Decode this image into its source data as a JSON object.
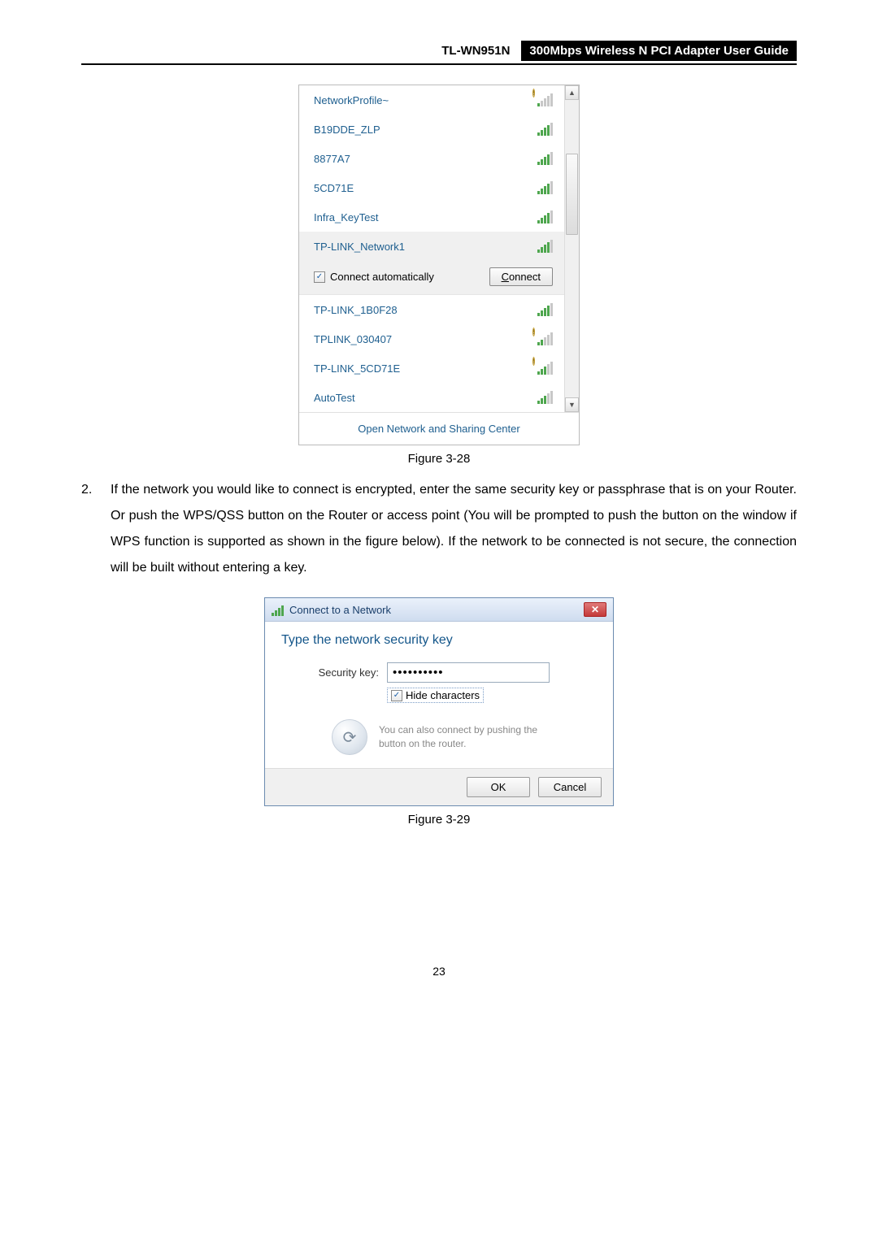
{
  "header": {
    "model": "TL-WN951N",
    "title": "300Mbps Wireless N PCI Adapter User Guide"
  },
  "wifi_panel": {
    "networks": [
      {
        "name": "NetworkProfile~",
        "strength": 1,
        "secured": true
      },
      {
        "name": "B19DDE_ZLP",
        "strength": 4,
        "secured": false
      },
      {
        "name": "8877A7",
        "strength": 4,
        "secured": false
      },
      {
        "name": "5CD71E",
        "strength": 4,
        "secured": false
      },
      {
        "name": "Infra_KeyTest",
        "strength": 4,
        "secured": false
      },
      {
        "name": "TP-LINK_Network1",
        "strength": 4,
        "secured": false,
        "selected": true
      }
    ],
    "connect": {
      "auto_label": "Connect automatically",
      "auto_checked": true,
      "button_label": "Connect",
      "button_underline": "C"
    },
    "networks_after": [
      {
        "name": "TP-LINK_1B0F28",
        "strength": 4,
        "secured": false
      },
      {
        "name": "TPLINK_030407",
        "strength": 2,
        "secured": true
      },
      {
        "name": "TP-LINK_5CD71E",
        "strength": 3,
        "secured": true
      },
      {
        "name": "AutoTest",
        "strength": 3,
        "secured": false
      }
    ],
    "footer_link": "Open Network and Sharing Center"
  },
  "caption1": "Figure 3-28",
  "step2": {
    "num": "2.",
    "text": "If the network you would like to connect is encrypted, enter the same security key or passphrase that is on your Router. Or push the WPS/QSS button on the Router or access point (You will be prompted to push the button on the window if WPS function is supported as shown in the figure below). If the network to be connected is not secure, the connection will be built without entering a key."
  },
  "dialog": {
    "title": "Connect to a Network",
    "heading": "Type the network security key",
    "field_label": "Security key:",
    "key_value": "••••••••••",
    "hide_label": "Hide characters",
    "hide_checked": true,
    "router_hint_l1": "You can also connect by pushing the",
    "router_hint_l2": "button on the router.",
    "ok_label": "OK",
    "cancel_label": "Cancel"
  },
  "caption2": "Figure 3-29",
  "page_number": "23"
}
